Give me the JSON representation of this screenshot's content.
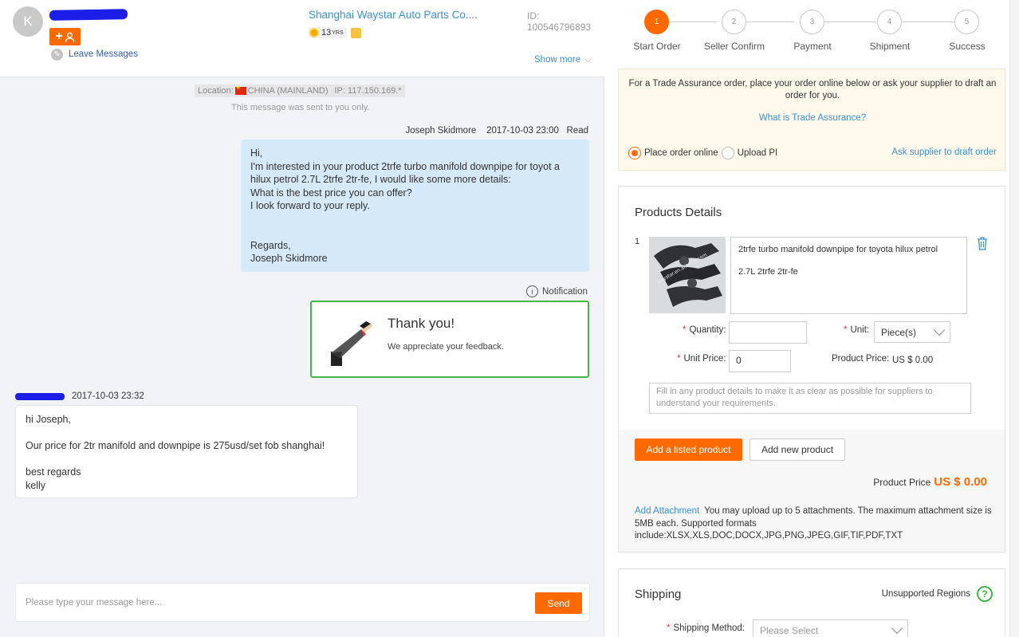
{
  "header": {
    "avatar_initial": "K",
    "leave_messages": "Leave Messages",
    "company_name": "Shanghai Waystar Auto Parts Co....",
    "years_count": "13",
    "years_suffix": "YRS",
    "member_id": "ID: 100546796893",
    "show_more": "Show more"
  },
  "chat": {
    "location_prefix": "Location:",
    "location_country": "CHINA (MAINLAND)",
    "location_ip": "IP: 117.150.169.*",
    "sent_note": "This message was sent to you only.",
    "my_message": {
      "sender": "Joseph Skidmore",
      "timestamp": "2017-10-03 23:00",
      "status": "Read",
      "body": "Hi,\nI'm interested in your product 2trfe turbo manifold downpipe for toyot a hilux petrol 2.7L 2trfe 2tr-fe, I would like some more details:\nWhat is the best price you can offer?\nI look forward to your reply.\n\n\nRegards,\nJoseph Skidmore"
    },
    "notification_label": "Notification",
    "thanks_title": "Thank you!",
    "thanks_text": "We appreciate your feedback.",
    "reply": {
      "timestamp": "2017-10-03 23:32",
      "body": "hi Joseph,\n\nOur price for 2tr manifold and downpipe is 275usd/set fob shanghai!\n\nbest regards\nkelly"
    },
    "compose_placeholder": "Please type your message here...",
    "send_label": "Send"
  },
  "steps": [
    {
      "num": "1",
      "label": "Start Order",
      "active": true
    },
    {
      "num": "2",
      "label": "Seller Confirm",
      "active": false
    },
    {
      "num": "3",
      "label": "Payment",
      "active": false
    },
    {
      "num": "4",
      "label": "Shipment",
      "active": false
    },
    {
      "num": "5",
      "label": "Success",
      "active": false
    }
  ],
  "trade_assurance": {
    "text": "For a Trade Assurance order, place your order online below or ask your supplier to draft an order for you.",
    "link": "What is Trade Assurance?",
    "option_online": "Place order online",
    "option_upload": "Upload PI",
    "ask_supplier": "Ask supplier to draft order"
  },
  "product_details": {
    "title": "Products Details",
    "item_number": "1",
    "image_watermark": "waystar.en.alibaba.com",
    "description": "2trfe turbo manifold downpipe for toyota hilux petrol\n\n2.7L 2trfe 2tr-fe",
    "quantity_label": "Quantity:",
    "quantity_value": "",
    "unit_label": "Unit:",
    "unit_value": "Piece(s)",
    "unit_price_label": "Unit Price:",
    "unit_price_value": "0",
    "product_price_label": "Product Price:",
    "product_price_value": "US $ 0.00",
    "details_placeholder": "Fill in any product details to make it as clear as possible for suppliers to understand your requirements.",
    "add_listed": "Add a listed product",
    "add_new": "Add new product",
    "total_label": "Product Price",
    "total_value": "US $ 0.00",
    "attachment_link": "Add Attachment",
    "attachment_text": "You may upload up to 5 attachments. The maximum attachment size is 5MB each. Supported formats include:XLSX,XLS,DOC,DOCX,JPG,PNG,JPEG,GIF,TIF,PDF,TXT"
  },
  "shipping": {
    "title": "Shipping",
    "unsupported": "Unsupported Regions",
    "method_label": "Shipping Method:",
    "method_placeholder": "Please Select"
  },
  "colors": {
    "accent": "#ff6a00",
    "link": "#3b8fd6",
    "success": "#42b649",
    "bubble_me": "#d6e9f8"
  }
}
